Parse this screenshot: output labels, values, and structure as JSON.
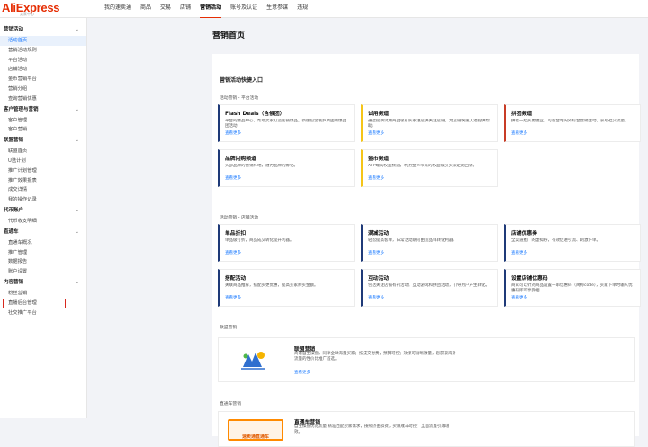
{
  "header": {
    "logo": "AliExpress",
    "logo_sub": "卖家中心",
    "nav": [
      "我的速卖通",
      "商品",
      "交易",
      "店铺",
      "营销活动",
      "账号及认证",
      "生意参谋",
      "违规"
    ],
    "active_nav_index": 4
  },
  "sidebar": {
    "groups": [
      {
        "label": "营销活动",
        "items": [
          "活动首页",
          "营销活动规则",
          "平台活动",
          "店铺活动",
          "金币营销平台",
          "营销分组",
          "查询营销优惠"
        ]
      },
      {
        "label": "客户管理与营销",
        "items": [
          "客户管理",
          "客户营销"
        ]
      },
      {
        "label": "联盟营销",
        "items": [
          "联盟首页",
          "U选计划",
          "推广计划管理",
          "推广效果报表",
          "成交详情",
          "我的操作记录"
        ]
      },
      {
        "label": "代币账户",
        "items": [
          "代币收支明细"
        ]
      },
      {
        "label": "直通车",
        "items": [
          "直通车概况",
          "推广管理",
          "数据报告",
          "账户设置"
        ]
      },
      {
        "label": "内容营销",
        "items": [
          "粉丝营销",
          "直播后台管理",
          "社交推广平台"
        ]
      }
    ],
    "active_item": "活动首页",
    "boxed_item": "直播后台管理"
  },
  "main": {
    "page_title": "营销首页",
    "quick_title": "营销活动快捷入口",
    "platform_label": "活动营销 - 平台活动",
    "store_label": "活动营销 - 店铺活动",
    "affiliate_label": "联盟营销",
    "ztc_label": "直通车营销",
    "more": "查看更多",
    "platform_cards": [
      {
        "title": "Flash Deals（含俄团）",
        "desc": "平台的爆品中心，帮助卖家打造店铺爆品。新版包含俄罗斯团购爆品团活动",
        "color": "navy"
      },
      {
        "title": "试用频道",
        "desc": "通过提供试用商品吸引买家进店并关注店铺，为店铺快速入池提供帮助。",
        "color": "yellow"
      },
      {
        "title": "拼团频道",
        "desc": "拼着一起买更便宜，可适合站内外综合营销活动，获取社交流量。",
        "color": "red"
      },
      {
        "title": "品牌闪购频道",
        "desc": "头部品牌的营销阵地，潜力品牌的孵化。",
        "color": "navy"
      },
      {
        "title": "金币频道",
        "desc": "APP端的权益频道，利用金币带来的权益吸引买家定期回访。",
        "color": "yellow"
      }
    ],
    "store_cards": [
      {
        "title": "单品折扣",
        "desc": "单品级打折，商品成交转化提升利器。"
      },
      {
        "title": "满减活动",
        "desc": "轻松提高客单，日常活动期可由货品单转化利器。"
      },
      {
        "title": "店铺优惠券",
        "desc": "全渠道推广的虚拟券，有效促进引流、刺激下单。"
      },
      {
        "title": "搭配活动",
        "desc": "关联商品推荐，搭配买更优惠，提高买家购买金额。"
      },
      {
        "title": "互动活动",
        "desc": "包括关注店铺有礼活动、互动游戏和拼团活动，引导用户产生转化。"
      },
      {
        "title": "设置店铺优惠码",
        "desc": "商家可以针对商品设置一串优惠码（简称code），买家下单时输入优惠码即可享受相..."
      }
    ],
    "affiliate": {
      "title": "联盟营销",
      "desc": "商家自主操盘，同享全球海量买家；按成交付费，预算可控；效果可清晰衡量，您获取海外流量的性价比推广首选。"
    },
    "ztc": {
      "title": "直通车营销",
      "desc": "自主操盘优化流量 精准匹配买家需求，按照点击扣费，买家成本可控，全面流量引爆增效。",
      "banner": "速卖通直通车"
    }
  }
}
